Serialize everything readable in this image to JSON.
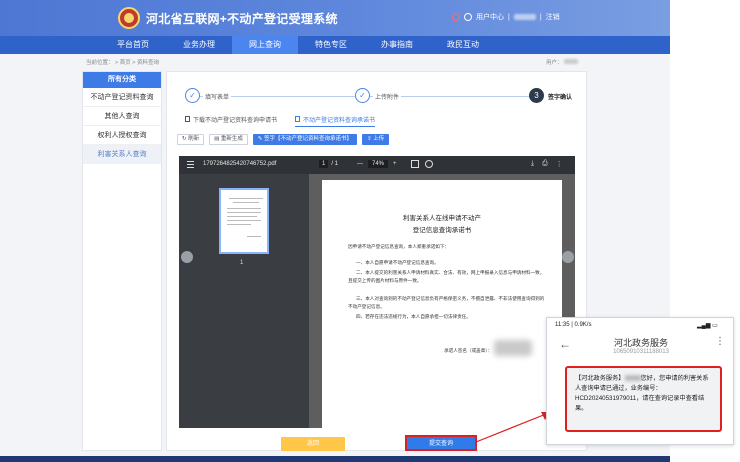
{
  "header": {
    "site_title": "河北省互联网+不动产登记受理系统",
    "user_center": "用户中心",
    "separator": "|",
    "logout": "注销"
  },
  "nav": {
    "items": [
      "平台首页",
      "业务办理",
      "网上查询",
      "特色专区",
      "办事指南",
      "政民互动"
    ],
    "active_index": 2
  },
  "breadcrumb": {
    "text": "当前位置： > 首页 > 资料查询",
    "user_label": "用户："
  },
  "sidebar": {
    "head": "所有分类",
    "items": [
      "不动产登记资料查询",
      "其他人查询",
      "权利人授权查询",
      "利害关系人查询"
    ],
    "active_index": 3
  },
  "steps": {
    "step1": "填写表单",
    "step2": "上传附件",
    "step3_num": "3",
    "step3": "签字确认",
    "check": "✓"
  },
  "tabs": {
    "tab1": "下载不动产登记资料查询申请书",
    "tab2": "不动产登记资料查询承诺书"
  },
  "toolbar": {
    "refresh": "刷新",
    "regenerate": "重新生成",
    "sign": "签字【不动产登记资料查询承诺书】",
    "upload": "上传"
  },
  "pdf": {
    "filename": "1797264825420746752.pdf",
    "page_current": "1",
    "page_sep": "/ 1",
    "zoom": "74%",
    "minus": "—",
    "plus": "+",
    "thumb_page_num": "1",
    "doc_title_line1": "利害关系人在线申请不动产",
    "doc_title_line2": "登记信息查询承诺书",
    "doc_intro": "因申请不动产登记信息查询，本人郑重承诺如下：",
    "doc_item1": "一、本人自愿申请不动产登记信息查询。",
    "doc_item2": "二、本人提交的利害关系人申请材料真实、合法、有效，网上申报录入信息与申请材料一致，且提交上传的图片材料与原件一致。",
    "doc_item3": "三、本人对查询到的不动产登记信息负有严格保密义务，不擅自泄露、不非法使用查询得到的不动产登记信息。",
    "doc_item4": "四、若存在违法违规行为，本人自愿承担一切法律责任。",
    "doc_sign_label": "承诺人签名（或盖章）："
  },
  "actions": {
    "back": "返回",
    "submit": "提交查询"
  },
  "phone": {
    "status_time": "11:35 | 0.9K/s",
    "title": "河北政务服务",
    "number": "10650910311188013",
    "msg_prefix": "【河北政务服务】",
    "msg_rest": "您好，您申请的利害关系人查询申请已通过，业务编号：HCD20240531979011，请在查询记录中查看结果。"
  },
  "colors": {
    "primary": "#3e7be6",
    "nav_bg": "#2f63c9",
    "highlight": "#e02020",
    "back_button": "#ffc64a"
  }
}
